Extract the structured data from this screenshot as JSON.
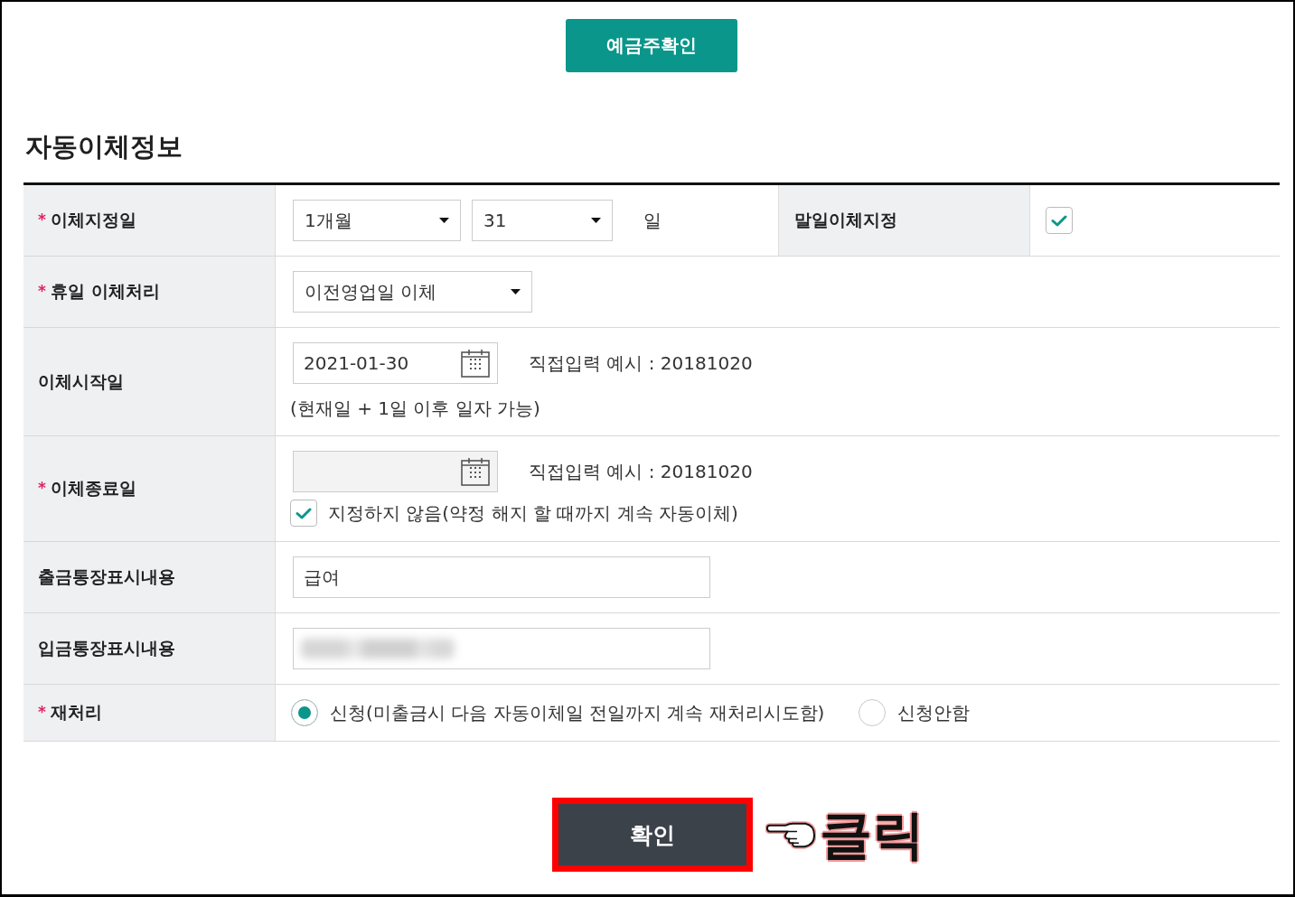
{
  "top_button": {
    "label": "예금주확인"
  },
  "section": {
    "title": "자동이체정보"
  },
  "rows": [
    {
      "kind": "day_select",
      "mark": "*",
      "label": "이체지정일",
      "selects": [
        "1개월",
        "31"
      ],
      "suffix": "일",
      "extra": {
        "label": "말일이체지정",
        "checked": true
      }
    },
    {
      "kind": "select",
      "mark": "*",
      "label": "휴일 이체처리",
      "value": "이전영업일 이체"
    },
    {
      "kind": "date",
      "label": "이체시작일",
      "value": "2021-01-30",
      "disabled": false,
      "hint": "직접입력 예시 : 20181020",
      "note": "(현재일 + 1일 이후 일자 가능)"
    },
    {
      "kind": "date",
      "mark": "*",
      "label": "이체종료일",
      "disabled": true,
      "hint": "직접입력 예시 : 20181020",
      "option": {
        "label": "지정하지 않음(약정 해지 할 때까지 계속 자동이체)",
        "checked": true
      }
    },
    {
      "kind": "text",
      "label": "출금통장표시내용",
      "value": "급여"
    },
    {
      "kind": "text",
      "label": "입금통장표시내용",
      "redacted": true
    },
    {
      "kind": "radio",
      "mark": "*",
      "label": "재처리",
      "options": [
        {
          "label": "신청(미출금시 다음 자동이체일 전일까지 계속 재처리시도함)",
          "selected": true
        },
        {
          "label": "신청안함",
          "selected": false
        }
      ]
    }
  ],
  "confirm_button": {
    "label": "확인",
    "highlighted": true
  },
  "annotation": {
    "text": "클릭"
  }
}
